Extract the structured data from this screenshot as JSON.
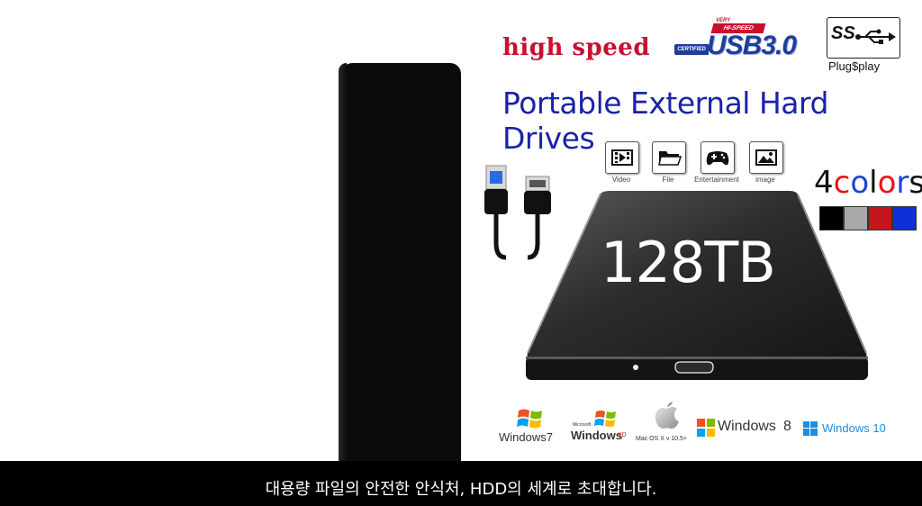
{
  "ad": {
    "high_speed": "high speed",
    "usb_very": "VERY",
    "usb_hi_speed": "HI-SPEED",
    "usb_certified": "CERTIFIED",
    "usb_label": "USB3.0",
    "ss_label": "SS",
    "plug_label": "Plug$play",
    "title": "Portable External Hard Drives",
    "features": [
      {
        "label": "Video",
        "icon": "video-icon"
      },
      {
        "label": "File",
        "icon": "folder-icon"
      },
      {
        "label": "Entertainment",
        "icon": "gamepad-icon"
      },
      {
        "label": "image",
        "icon": "image-icon"
      }
    ],
    "colors_title_num": "4",
    "colors_title_word": [
      "c",
      "o",
      "l",
      "o",
      "r",
      "s"
    ],
    "colors_title_hex": [
      "#e8141c",
      "#1e44d4",
      "#111111",
      "#e8141c",
      "#1e44d4",
      "#111111"
    ],
    "swatches": [
      "#000000",
      "#a8a8a8",
      "#c3161c",
      "#0f2fd8"
    ],
    "capacity": "128TB",
    "os": {
      "win7": "Windows7",
      "winxp_small": "Microsoft",
      "winxp": "Windows",
      "winxp_sup": "xp",
      "mac": "Mac OS X v 10.5+",
      "win8": "Windows",
      "win8_num": "8",
      "win10": "Windows 10"
    }
  },
  "caption": "대용량 파일의 안전한 안식처, HDD의 세계로 초대합니다."
}
